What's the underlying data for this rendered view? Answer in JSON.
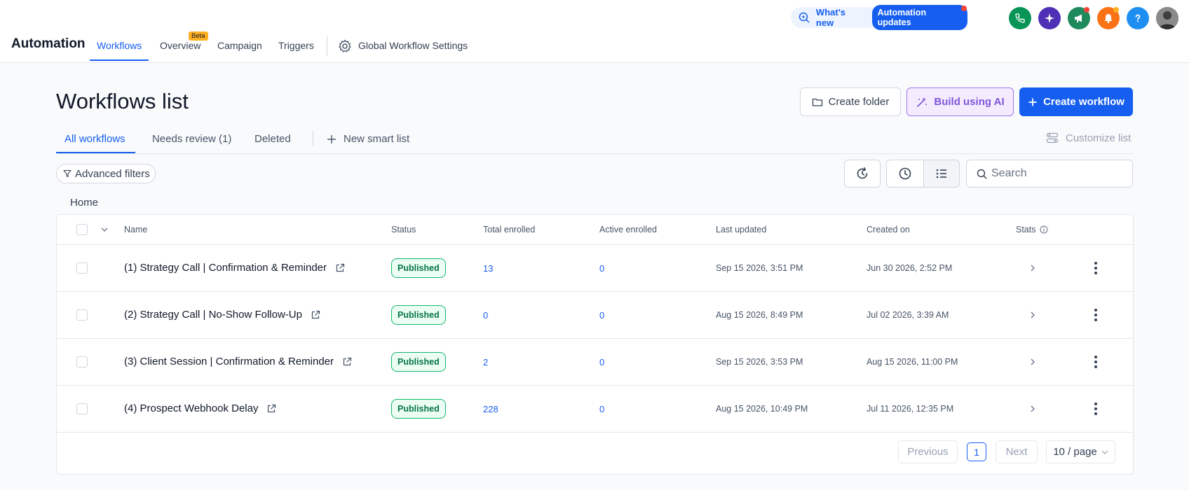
{
  "header": {
    "whats_new": "What's new",
    "automation_updates": "Automation updates",
    "app_title": "Automation",
    "nav": [
      {
        "label": "Workflows"
      },
      {
        "label": "Overview"
      },
      {
        "label": "Campaign"
      },
      {
        "label": "Triggers"
      }
    ],
    "beta_badge": "Beta",
    "global_settings": "Global Workflow Settings",
    "icon_colors": {
      "phone": "#079455",
      "ai": "#4e2fb5",
      "megaphone": "#1f8a5c",
      "bell": "#f97316",
      "help": "#1f8ef1"
    }
  },
  "page": {
    "title": "Workflows list",
    "buttons": {
      "create_folder": "Create folder",
      "build_ai": "Build using AI",
      "create_workflow": "Create workflow"
    },
    "tabs": [
      {
        "label": "All workflows"
      },
      {
        "label": "Needs review (1)"
      },
      {
        "label": "Deleted"
      }
    ],
    "new_smart_list": "New smart list",
    "customize_list": "Customize list",
    "advanced_filters": "Advanced filters",
    "search_placeholder": "Search",
    "breadcrumb": "Home"
  },
  "table": {
    "columns": [
      "Name",
      "Status",
      "Total enrolled",
      "Active enrolled",
      "Last updated",
      "Created on",
      "Stats"
    ],
    "rows": [
      {
        "name": "(1) Strategy Call | Confirmation & Reminder",
        "status": "Published",
        "total": "13",
        "active": "0",
        "updated": "Sep 15 2026, 3:51 PM",
        "created": "Jun 30 2026, 2:52 PM"
      },
      {
        "name": "(2) Strategy Call | No-Show Follow-Up",
        "status": "Published",
        "total": "0",
        "active": "0",
        "updated": "Aug 15 2026, 8:49 PM",
        "created": "Jul 02 2026, 3:39 AM"
      },
      {
        "name": "(3) Client Session | Confirmation & Reminder",
        "status": "Published",
        "total": "2",
        "active": "0",
        "updated": "Sep 15 2026, 3:53 PM",
        "created": "Aug 15 2026, 11:00 PM"
      },
      {
        "name": "(4) Prospect Webhook Delay",
        "status": "Published",
        "total": "228",
        "active": "0",
        "updated": "Aug 15 2026, 10:49 PM",
        "created": "Jul 11 2026, 12:35 PM"
      }
    ]
  },
  "pagination": {
    "previous": "Previous",
    "page": "1",
    "next": "Next",
    "per_page": "10 / page"
  }
}
